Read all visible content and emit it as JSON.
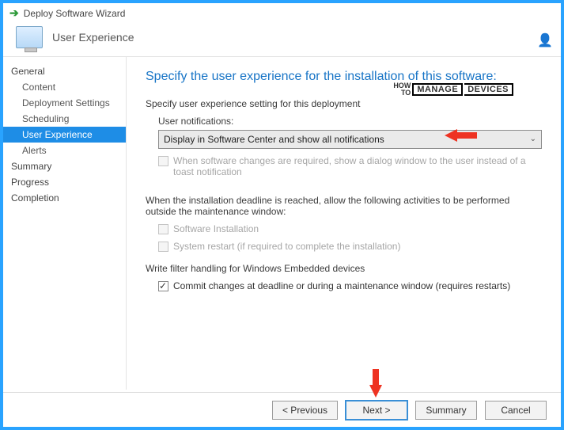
{
  "window": {
    "title": "Deploy Software Wizard",
    "header": "User Experience"
  },
  "sidebar": {
    "items": [
      {
        "label": "General",
        "sub": false
      },
      {
        "label": "Content",
        "sub": true
      },
      {
        "label": "Deployment Settings",
        "sub": true
      },
      {
        "label": "Scheduling",
        "sub": true
      },
      {
        "label": "User Experience",
        "sub": true,
        "selected": true
      },
      {
        "label": "Alerts",
        "sub": true
      },
      {
        "label": "Summary",
        "sub": false
      },
      {
        "label": "Progress",
        "sub": false
      },
      {
        "label": "Completion",
        "sub": false
      }
    ]
  },
  "content": {
    "heading": "Specify the user experience for the installation of this software:",
    "intro": "Specify user experience setting for this deployment",
    "user_notifications_label": "User notifications:",
    "user_notifications_value": "Display in Software Center and show all notifications",
    "toast_checkbox": "When software changes are required, show a dialog window to the user instead of a toast notification",
    "deadline_text": "When the installation deadline is reached, allow the following activities to be performed outside the maintenance window:",
    "sw_install_checkbox": "Software Installation",
    "restart_checkbox": "System restart  (if required to complete the installation)",
    "write_filter_label": "Write filter handling for Windows Embedded devices",
    "commit_checkbox": "Commit changes at deadline or during a maintenance window (requires restarts)"
  },
  "watermark": {
    "how": "HOW",
    "to": "TO",
    "manage": "MANAGE",
    "devices": "DEVICES"
  },
  "footer": {
    "previous": "< Previous",
    "next": "Next >",
    "summary": "Summary",
    "cancel": "Cancel"
  }
}
